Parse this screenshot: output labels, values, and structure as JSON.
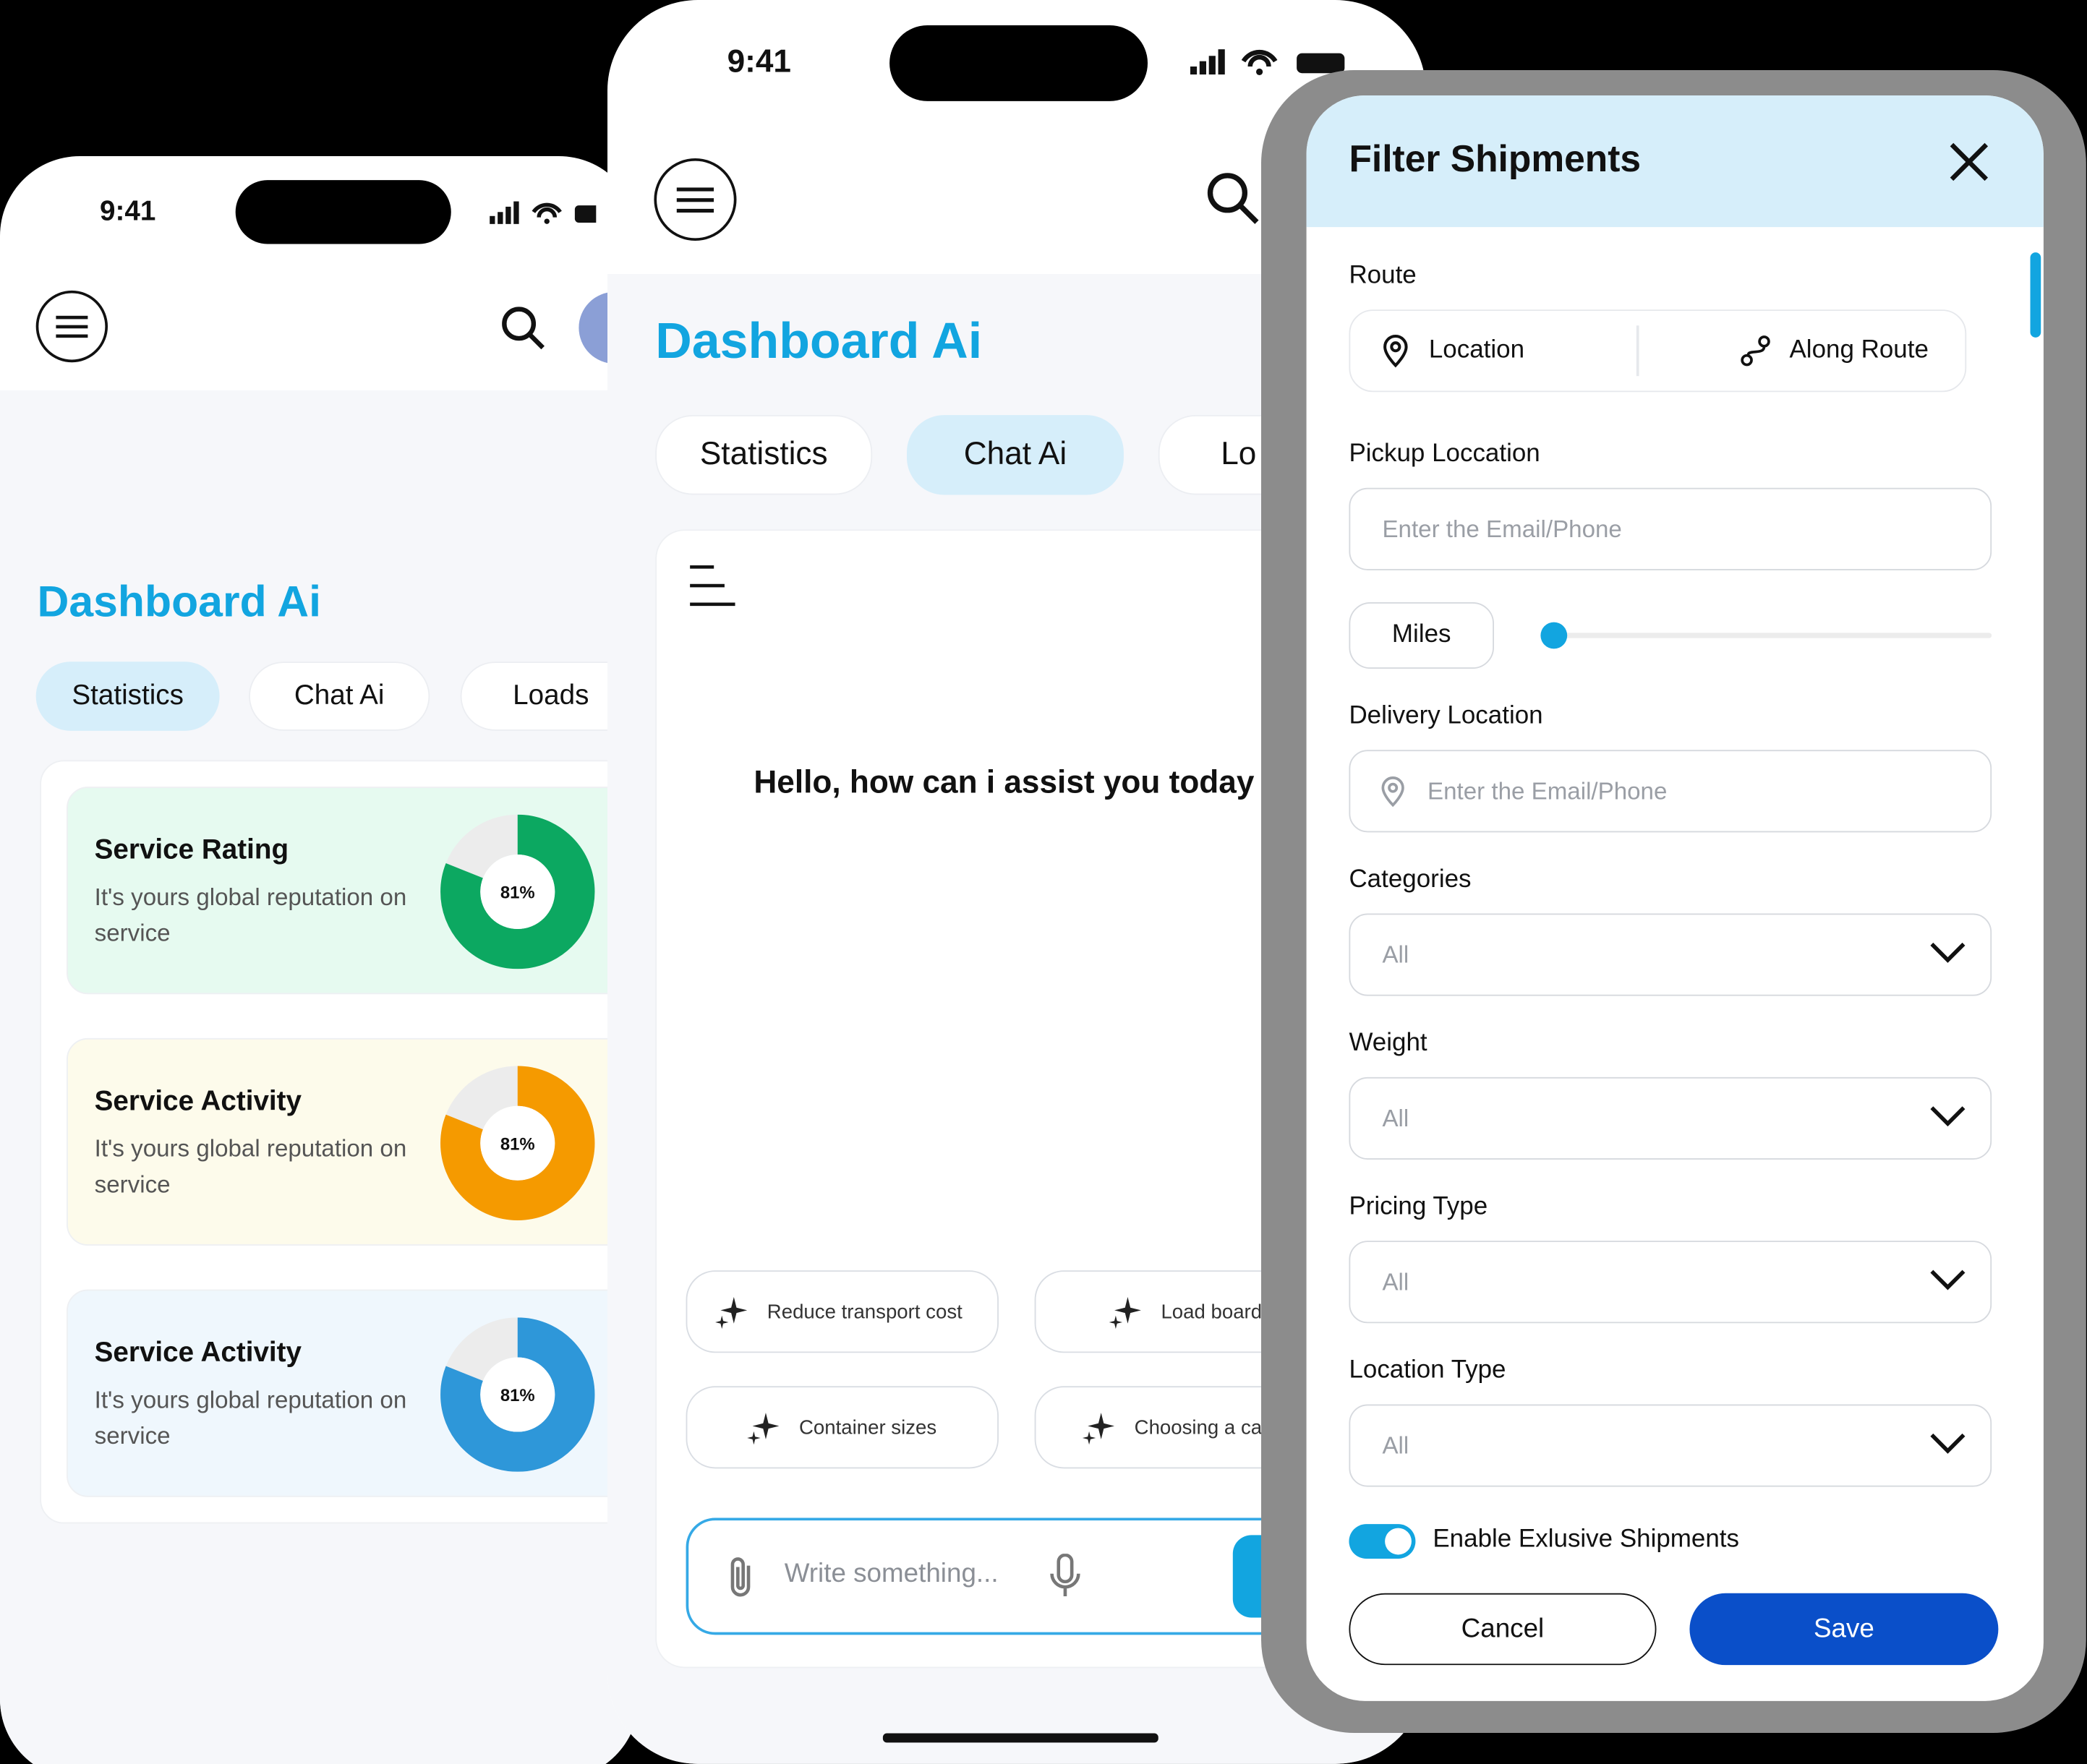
{
  "colors": {
    "accent": "#12A5E0",
    "green": "#0CA861",
    "orange": "#F59A00",
    "blue": "#2E97D9",
    "save": "#0A4FC9",
    "active_tab": "#D6EEFA"
  },
  "phone1": {
    "time": "9:41",
    "title": "Dashboard Ai",
    "tabs": [
      "Statistics",
      "Chat Ai",
      "Loads"
    ],
    "cards": [
      {
        "title": "Service Rating",
        "subtitle": "It's yours global reputation on service",
        "percent": "81%",
        "value": 81,
        "color": "green"
      },
      {
        "title": "Service Activity",
        "subtitle": "It's yours global reputation on service",
        "percent": "81%",
        "value": 81,
        "color": "orange"
      },
      {
        "title": "Service Activity",
        "subtitle": "It's yours global reputation on service",
        "percent": "81%",
        "value": 81,
        "color": "blue"
      }
    ]
  },
  "phone2": {
    "time": "9:41",
    "title": "Dashboard Ai",
    "tabs": [
      "Statistics",
      "Chat Ai",
      "Lo"
    ],
    "greeting": "Hello, how can i assist you today",
    "suggestions": [
      "Reduce transport cost",
      "Load board",
      "Container sizes",
      "Choosing a ca"
    ],
    "input_placeholder": "Write something..."
  },
  "filter": {
    "title": "Filter Shipments",
    "route_label": "Route",
    "route_options": [
      "Location",
      "Along Route"
    ],
    "pickup_label": "Pickup Loccation",
    "pickup_placeholder": "Enter the Email/Phone",
    "miles_label": "Miles",
    "miles_value": 0,
    "delivery_label": "Delivery Location",
    "delivery_placeholder": "Enter the Email/Phone",
    "categories_label": "Categories",
    "categories_value": "All",
    "weight_label": "Weight",
    "weight_value": "All",
    "pricing_label": "Pricing Type",
    "pricing_value": "All",
    "location_type_label": "Location Type",
    "location_type_value": "All",
    "toggle_label": "Enable Exlusive Shipments",
    "toggle_on": true,
    "cancel": "Cancel",
    "save": "Save"
  }
}
